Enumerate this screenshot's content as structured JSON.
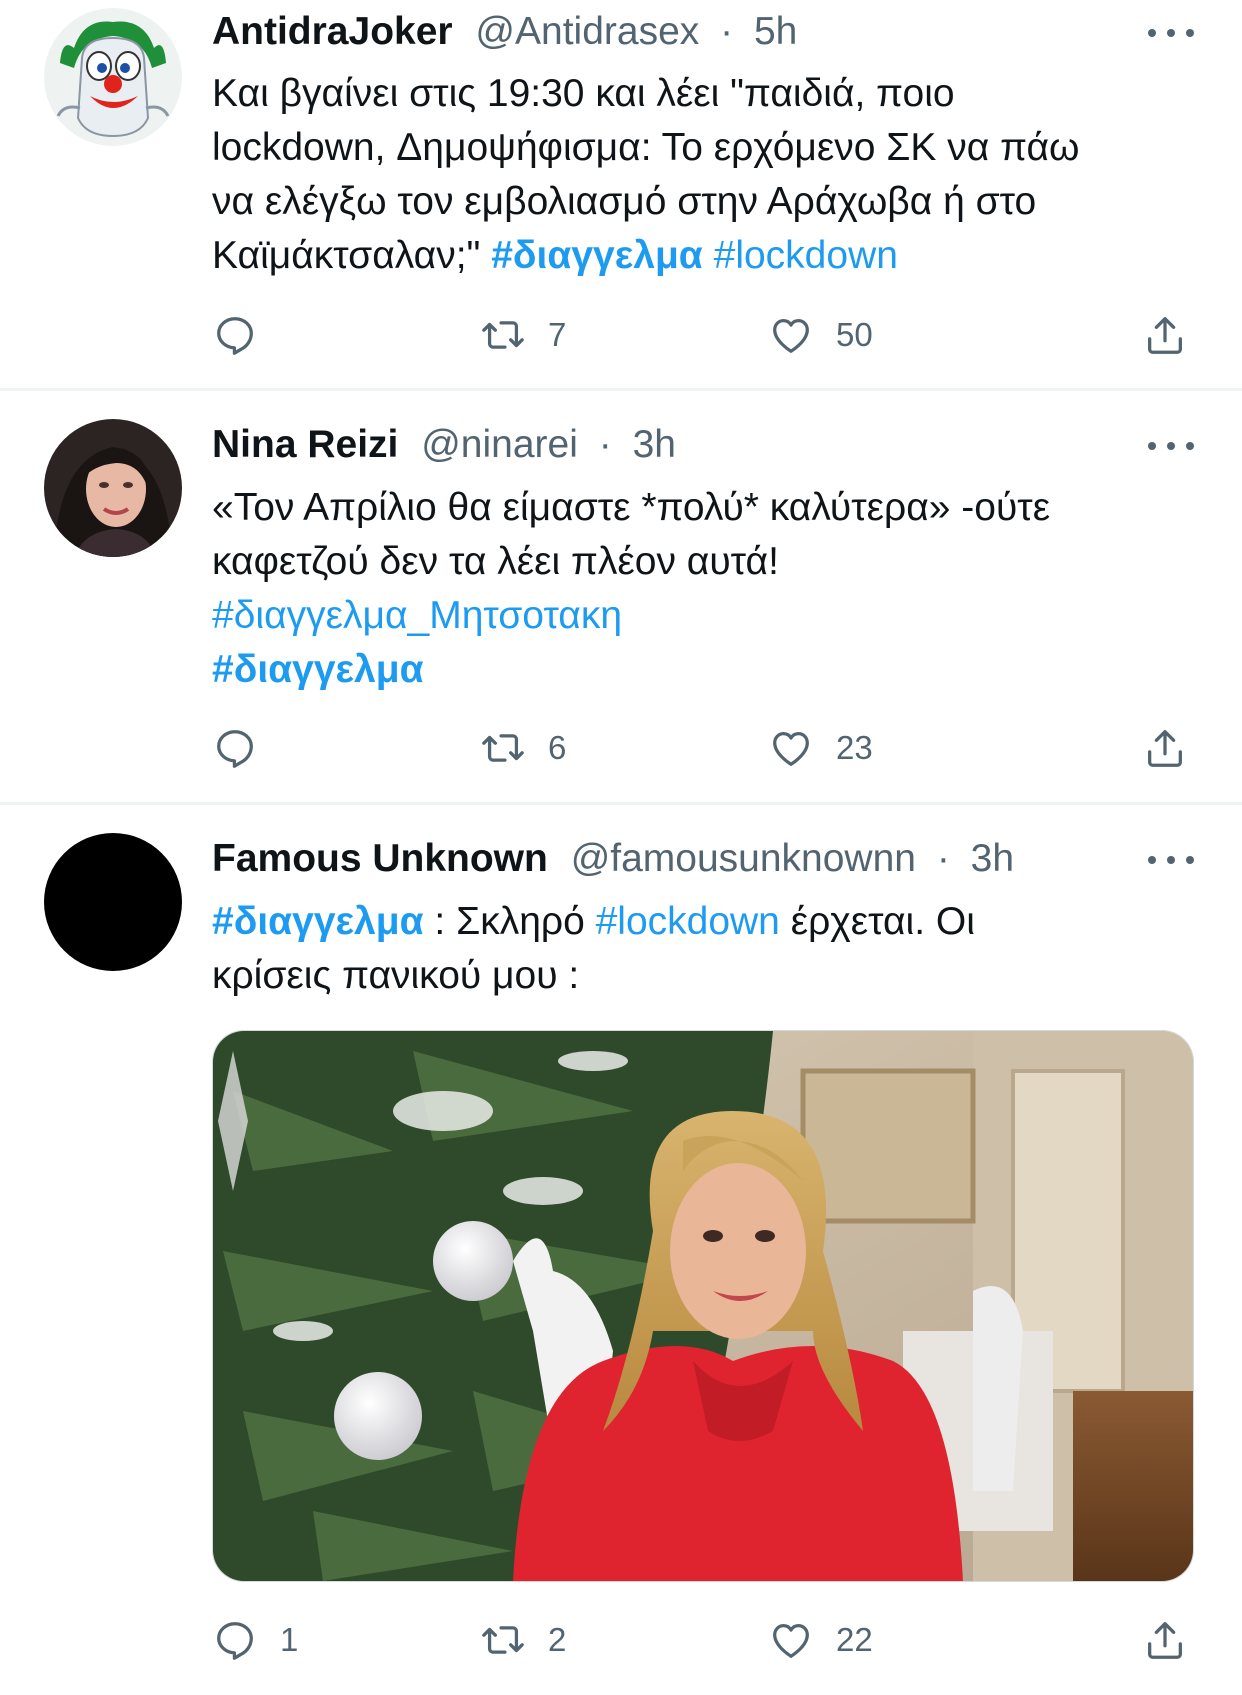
{
  "tweets": [
    {
      "name": "AntidraJoker",
      "handle": "@Antidrasex",
      "sep": "·",
      "time": "5h",
      "text": {
        "line1": "Και βγαίνει στις 19:30 και λέει \"παιδιά, ποιο",
        "line2": "lockdown, Δημοψήφισμα: Το ερχόμενο ΣΚ να πάω",
        "line3": "να ελέγξω τον εμβολιασμό στην Αράχωβα ή στο",
        "line4_plain": "Καϊμάκτσαλαν;\" ",
        "tag1": "#διαγγελμα",
        "tag2": "#lockdown"
      },
      "reply_count": "",
      "retweet_count": "7",
      "like_count": "50"
    },
    {
      "name": "Nina Reizi",
      "handle": "@ninarei",
      "sep": "·",
      "time": "3h",
      "text": {
        "line1": "«Τον Απρίλιο θα είμαστε *πολύ* καλύτερα» -ούτε",
        "line2": "καφετζού δεν τα λέει πλέον αυτά!",
        "tag1": "#διαγγελμα_Μητσοτακη",
        "tag2": "#διαγγελμα"
      },
      "reply_count": "",
      "retweet_count": "6",
      "like_count": "23"
    },
    {
      "name": "Famous Unknown",
      "handle": "@famousunknownn",
      "sep": "·",
      "time": "3h",
      "text": {
        "tag1": "#διαγγελμα",
        "mid1": " : Σκληρό ",
        "tag2": "#lockdown",
        "mid2": " έρχεται. Οι",
        "line2": "κρίσεις πανικού μου :"
      },
      "reply_count": "1",
      "retweet_count": "2",
      "like_count": "22"
    }
  ],
  "icons": [
    "joker-avatar",
    "portrait-avatar",
    "black-avatar",
    "more-icon",
    "reply-icon",
    "retweet-icon",
    "like-icon",
    "share-icon"
  ],
  "colors": {
    "link": "#1d9bf0",
    "muted": "#536471",
    "text": "#0f1419",
    "divider": "#eff3f4"
  }
}
